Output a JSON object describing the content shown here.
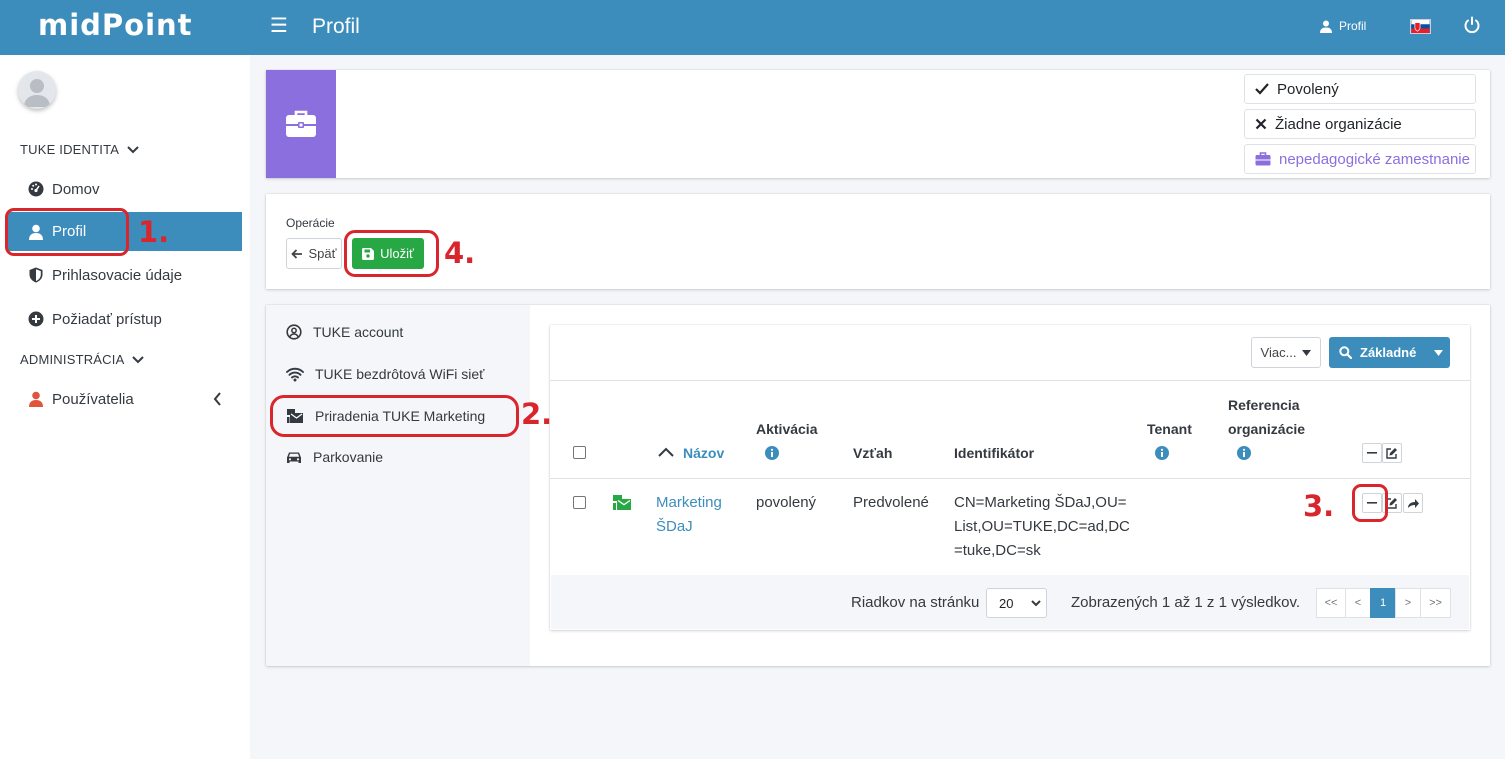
{
  "app": {
    "logo": "midPoint",
    "page_title": "Profil",
    "user_label": "Profil"
  },
  "sidebar": {
    "section1": "TUKE IDENTITA",
    "items": [
      {
        "label": "Domov",
        "icon": "dashboard-icon"
      },
      {
        "label": "Profil",
        "icon": "user-icon",
        "active": true
      },
      {
        "label": "Prihlasovacie údaje",
        "icon": "shield-icon"
      },
      {
        "label": "Požiadať prístup",
        "icon": "plus-circle-icon"
      }
    ],
    "section2": "ADMINISTRÁCIA",
    "admin_items": [
      {
        "label": "Používatelia",
        "icon": "user-icon"
      }
    ]
  },
  "summary": {
    "tags": [
      {
        "label": "Povolený",
        "icon": "check-icon"
      },
      {
        "label": "Žiadne organizácie",
        "icon": "times-icon"
      },
      {
        "label": "nepedagogické zamestnanie",
        "icon": "briefcase-icon",
        "color": "#8c6fde"
      }
    ]
  },
  "operations": {
    "title": "Operácie",
    "back": "Späť",
    "save": "Uložiť"
  },
  "tabs": [
    {
      "label": "TUKE account",
      "icon": "user-circle-icon"
    },
    {
      "label": "TUKE bezdrôtová WiFi sieť",
      "icon": "wifi-icon"
    },
    {
      "label": "Priradenia TUKE Marketing",
      "icon": "mail-bulk-icon",
      "active": true
    },
    {
      "label": "Parkovanie",
      "icon": "car-icon"
    }
  ],
  "table": {
    "more_button": "Viac...",
    "search_button": "Základné",
    "headers": {
      "name": "Názov",
      "activation": "Aktivácia",
      "relation": "Vzťah",
      "identifier": "Identifikátor",
      "tenant": "Tenant",
      "orgref_line1": "Referencia",
      "orgref_line2": "organizácie"
    },
    "rows": [
      {
        "name_line1": "Marketing",
        "name_line2": "ŠDaJ",
        "activation": "povolený",
        "relation": "Predvolené",
        "id_line1": "CN=Marketing ŠDaJ,OU=",
        "id_line2": "List,OU=TUKE,DC=ad,DC",
        "id_line3": "=tuke,DC=sk"
      }
    ],
    "footer": {
      "rows_label": "Riadkov na stránku",
      "page_size": "20",
      "summary": "Zobrazených 1 až 1 z 1 výsledkov."
    },
    "pagination": {
      "first": "<<",
      "prev": "<",
      "current": "1",
      "next": ">",
      "last": ">>"
    }
  },
  "annotations": {
    "n1": "1.",
    "n2": "2.",
    "n3": "3.",
    "n4": "4."
  },
  "colors": {
    "header": "#3c8dbc",
    "accent_purple": "#8c6fde",
    "save_green": "#28a745",
    "annotation_red": "#d9262c",
    "link": "#3c8dbc"
  }
}
